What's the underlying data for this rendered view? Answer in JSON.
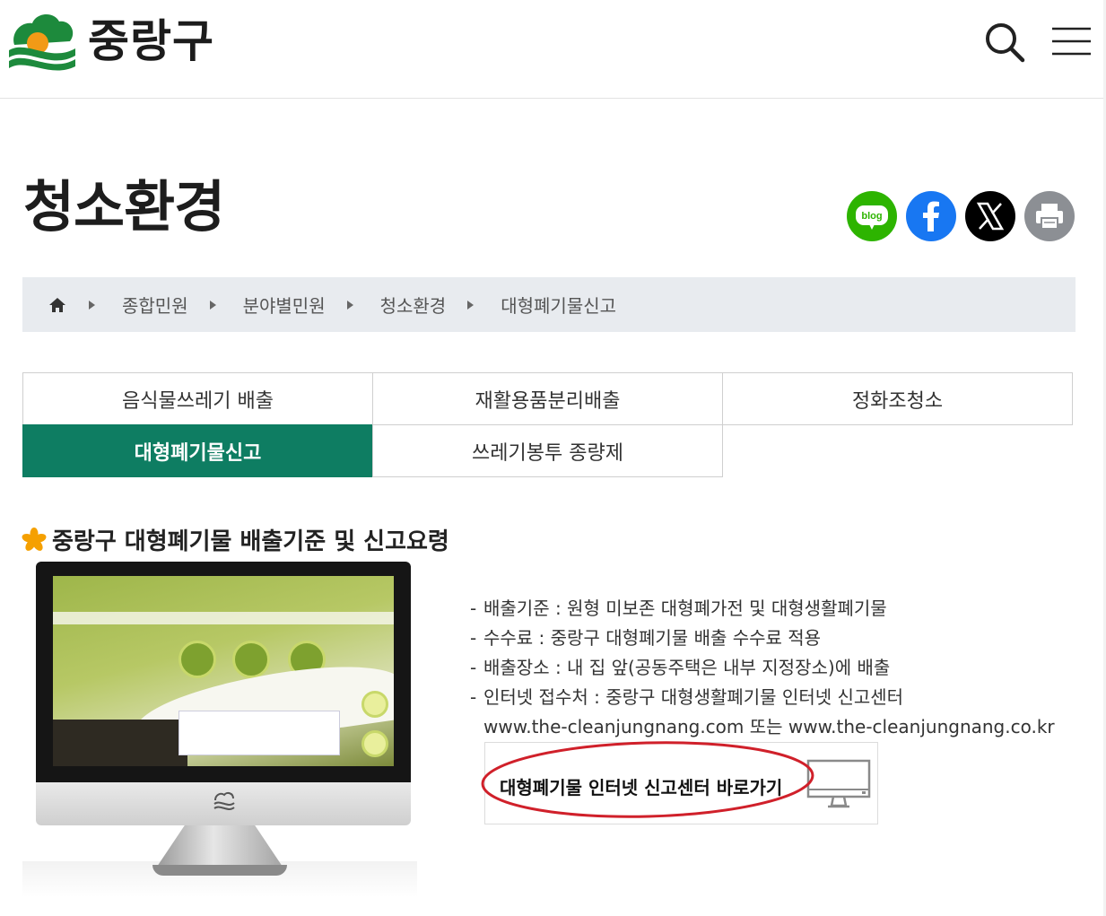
{
  "header": {
    "logo_text": "중랑구",
    "search_icon": "search-icon",
    "menu_icon": "hamburger-menu-icon"
  },
  "page": {
    "title": "청소환경"
  },
  "share": [
    {
      "name": "blog",
      "label": "blog",
      "color": "#2db400"
    },
    {
      "name": "facebook",
      "label": "f",
      "color": "#1877f2"
    },
    {
      "name": "x",
      "label": "X",
      "color": "#000000"
    },
    {
      "name": "print",
      "label": "",
      "color": "#8c8f94"
    }
  ],
  "breadcrumb": {
    "home_icon": "home-icon",
    "items": [
      "종합민원",
      "분야별민원",
      "청소환경",
      "대형폐기물신고"
    ]
  },
  "tabs": [
    {
      "label": "음식물쓰레기 배출",
      "active": false
    },
    {
      "label": "재활용품분리배출",
      "active": false
    },
    {
      "label": "정화조청소",
      "active": false
    },
    {
      "label": "대형폐기물신고",
      "active": true
    },
    {
      "label": "쓰레기봉투 종량제",
      "active": false
    }
  ],
  "section": {
    "title": "중랑구 대형폐기물 배출기준 및 신고요령",
    "items": [
      "배출기준 : 원형 미보존 대형폐가전 및 대형생활폐기물",
      "수수료 : 중랑구 대형폐기물 배출 수수료 적용",
      "배출장소 : 내 집 앞(공동주택은 내부 지정장소)에 배출",
      "인터넷 접수처 : 중랑구 대형생활폐기물 인터넷 신고센터"
    ],
    "urls": "www.the-cleanjungnang.com 또는 www.the-cleanjungnang.co.kr",
    "link_button": "대형폐기물 인터넷 신고센터 바로가기"
  },
  "colors": {
    "brand_green": "#0e7d62",
    "annotation_red": "#d0202a"
  }
}
